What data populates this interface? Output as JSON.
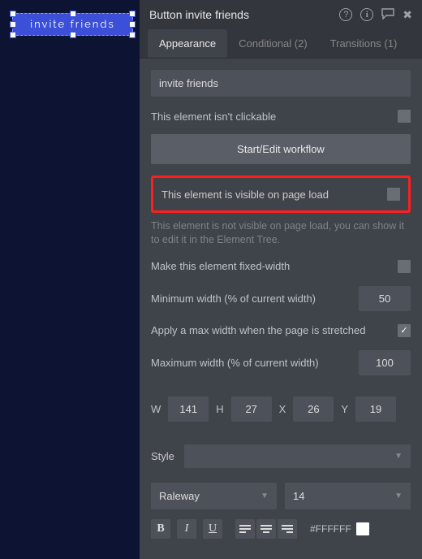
{
  "canvas": {
    "button_text": "invite friends"
  },
  "header": {
    "title": "Button invite friends",
    "icons": {
      "help": "?",
      "info": "i",
      "comment": "💬",
      "close": "✖"
    }
  },
  "tabs": {
    "appearance": "Appearance",
    "conditional": "Conditional (2)",
    "transitions": "Transitions (1)"
  },
  "fields": {
    "name_value": "invite friends",
    "clickable_label": "This element isn't clickable",
    "workflow_label": "Start/Edit workflow",
    "visible_label": "This element is visible on page load",
    "visible_help": "This element is not visible on page load, you can show it to edit it in the Element Tree.",
    "fixed_width_label": "Make this element fixed-width",
    "min_width_label": "Minimum width (% of current width)",
    "min_width_value": "50",
    "max_apply_label": "Apply a max width when the page is stretched",
    "max_width_label": "Maximum width (% of current width)",
    "max_width_value": "100"
  },
  "dims": {
    "W": "141",
    "H": "27",
    "X": "26",
    "Y": "19",
    "w_label": "W",
    "h_label": "H",
    "x_label": "X",
    "y_label": "Y"
  },
  "style": {
    "label": "Style",
    "value": ""
  },
  "font": {
    "family": "Raleway",
    "size": "14"
  },
  "color": {
    "hex": "#FFFFFF"
  }
}
